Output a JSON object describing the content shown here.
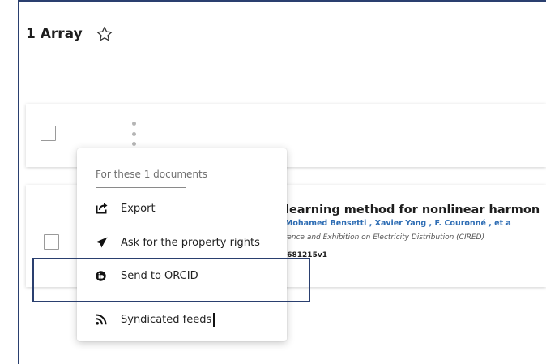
{
  "header": {
    "title": "1 Array",
    "favorite_icon": "star-outline-icon"
  },
  "document": {
    "title": "learning method for nonlinear harmon",
    "authors": ", Mohamed Bensetti , Xavier Yang , F. Couronné , et a",
    "venue": "erence and Exhibition on Electricity Distribution (CIRED)",
    "identifier": "3681215v1"
  },
  "context_menu": {
    "header": "For these 1 documents",
    "items": [
      {
        "label": "Export",
        "icon": "export-icon"
      },
      {
        "label": "Ask for the property rights",
        "icon": "send-icon"
      },
      {
        "label": "Send to ORCID",
        "icon": "orcid-icon"
      },
      {
        "label": "Syndicated feeds",
        "icon": "rss-icon"
      }
    ]
  },
  "colors": {
    "frame_border": "#2a3f6f",
    "author_link": "#2e6db4",
    "highlight_box": "#2a3f6f"
  }
}
